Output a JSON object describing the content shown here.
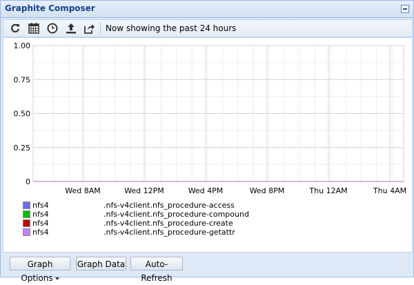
{
  "window": {
    "title": "Graphite Composer"
  },
  "toolbar": {
    "icons": [
      "refresh-icon",
      "calendar-icon",
      "clock-icon",
      "upload-icon",
      "share-icon"
    ],
    "status_text": "Now showing the past 24 hours"
  },
  "legend": [
    {
      "host": "nfs4",
      "metric": ".nfs-v4client.nfs_procedure-access",
      "color": "#6c6cf0"
    },
    {
      "host": "nfs4",
      "metric": ".nfs-v4client.nfs_procedure-compound",
      "color": "#00c000"
    },
    {
      "host": "nfs4",
      "metric": ".nfs-v4client.nfs_procedure-create",
      "color": "#c00000"
    },
    {
      "host": "nfs4",
      "metric": ".nfs-v4client.nfs_procedure-getattr",
      "color": "#c080ff"
    }
  ],
  "buttons": {
    "graph_options": "Graph Options",
    "graph_data": "Graph Data",
    "auto_refresh": "Auto-Refresh"
  },
  "chart_data": {
    "type": "line",
    "title": "",
    "xlabel": "",
    "ylabel": "",
    "ylim": [
      0,
      1
    ],
    "y_ticks": [
      "1.00",
      "0.75",
      "0.50",
      "0.25",
      "0"
    ],
    "x_ticks": [
      "Wed  8AM",
      "Wed 12PM",
      "Wed  4PM",
      "Wed  8PM",
      "Thu 12AM",
      "Thu  4AM"
    ],
    "grid": true,
    "series": [
      {
        "name": "nfs4 .nfs-v4client.nfs_procedure-access",
        "values": [
          0,
          0,
          0,
          0,
          0,
          0
        ]
      },
      {
        "name": "nfs4 .nfs-v4client.nfs_procedure-compound",
        "values": [
          0,
          0,
          0,
          0,
          0,
          0
        ]
      },
      {
        "name": "nfs4 .nfs-v4client.nfs_procedure-create",
        "values": [
          0,
          0,
          0,
          0,
          0,
          0
        ]
      },
      {
        "name": "nfs4 .nfs-v4client.nfs_procedure-getattr",
        "values": [
          0,
          0,
          0,
          0,
          0,
          0
        ]
      }
    ]
  }
}
